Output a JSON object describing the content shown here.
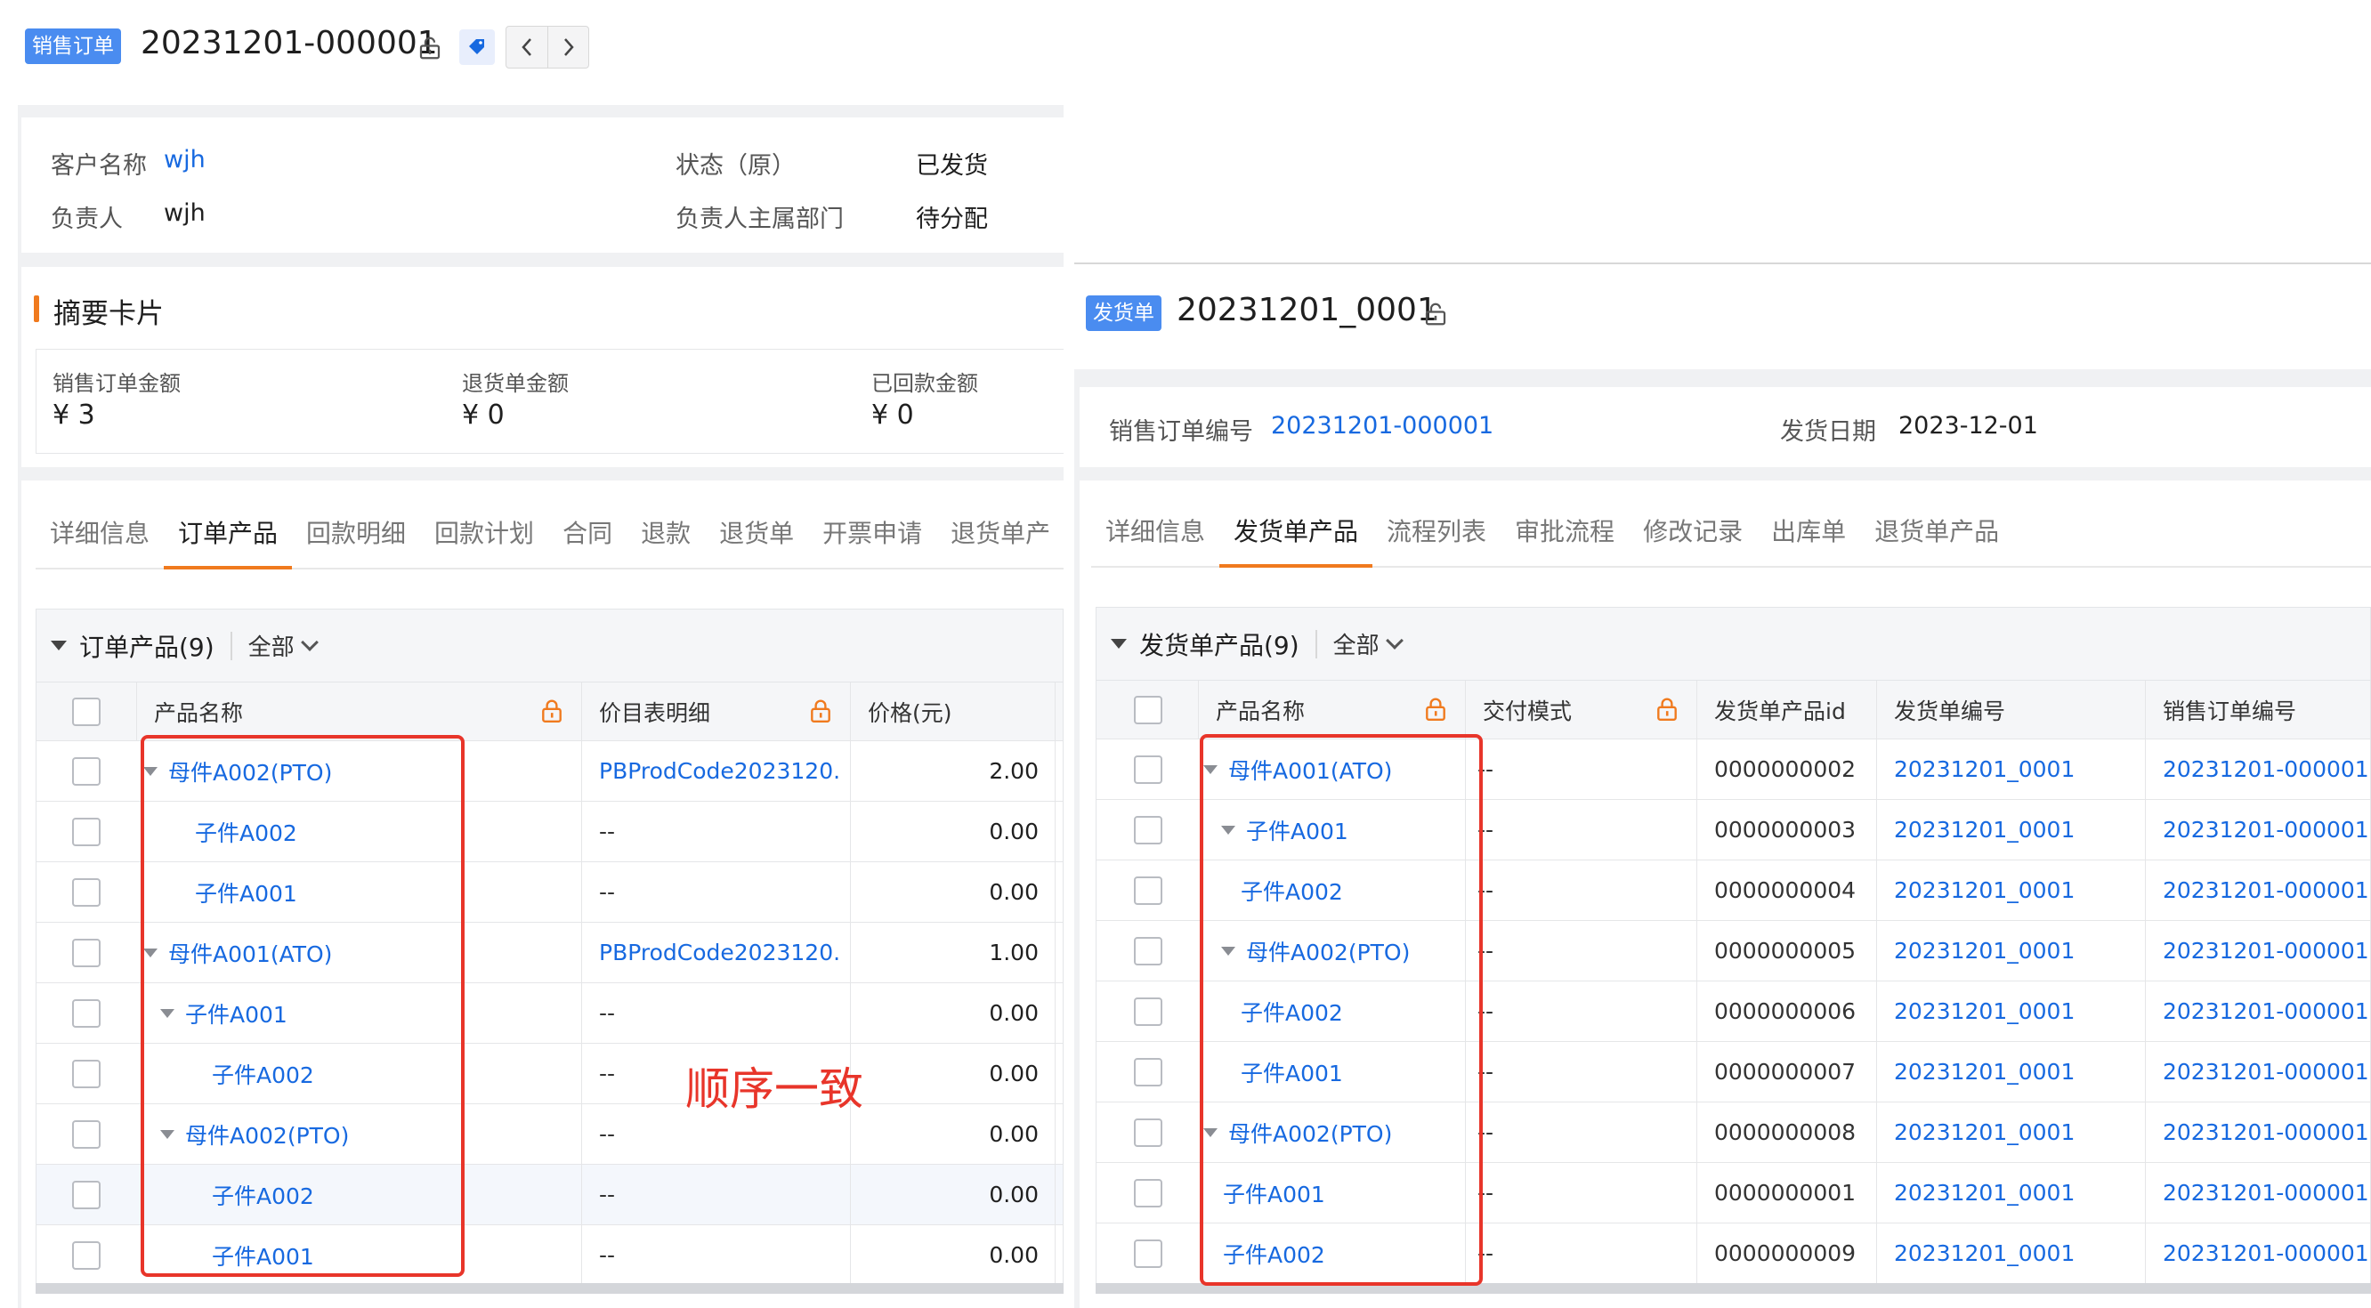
{
  "left": {
    "tag": "销售订单",
    "doc_no": "20231201-000001",
    "info": {
      "customer_label": "客户名称",
      "customer_value": "wjh",
      "status_label": "状态（原）",
      "status_value": "已发货",
      "owner_label": "负责人",
      "owner_value": "wjh",
      "dept_label": "负责人主属部门",
      "dept_value": "待分配"
    },
    "summary": {
      "title": "摘要卡片",
      "items": [
        {
          "label": "销售订单金额",
          "value": "¥ 3"
        },
        {
          "label": "退货单金额",
          "value": "¥ 0"
        },
        {
          "label": "已回款金额",
          "value": "¥ 0"
        }
      ]
    },
    "tabs": [
      "详细信息",
      "订单产品",
      "回款明细",
      "回款计划",
      "合同",
      "退款",
      "退货单",
      "开票申请",
      "退货单产"
    ],
    "active_tab": 1,
    "table": {
      "title": "订单产品(9)",
      "filter": "全部",
      "headers": [
        "产品名称",
        "价目表明细",
        "价格(元)"
      ],
      "rows": [
        {
          "name": "母件A002(PTO)",
          "detail": "PBProdCode2023120...",
          "price": "2.00"
        },
        {
          "name": "子件A002",
          "detail": "--",
          "price": "0.00"
        },
        {
          "name": "子件A001",
          "detail": "--",
          "price": "0.00"
        },
        {
          "name": "母件A001(ATO)",
          "detail": "PBProdCode2023120...",
          "price": "1.00"
        },
        {
          "name": "子件A001",
          "detail": "--",
          "price": "0.00"
        },
        {
          "name": "子件A002",
          "detail": "--",
          "price": "0.00"
        },
        {
          "name": "母件A002(PTO)",
          "detail": "--",
          "price": "0.00"
        },
        {
          "name": "子件A002",
          "detail": "--",
          "price": "0.00"
        },
        {
          "name": "子件A001",
          "detail": "--",
          "price": "0.00"
        }
      ]
    },
    "annotation": "顺序一致"
  },
  "right": {
    "tag": "发货单",
    "doc_no": "20231201_0001",
    "info": {
      "order_no_label": "销售订单编号",
      "order_no_value": "20231201-000001",
      "date_label": "发货日期",
      "date_value": "2023-12-01"
    },
    "tabs": [
      "详细信息",
      "发货单产品",
      "流程列表",
      "审批流程",
      "修改记录",
      "出库单",
      "退货单产品"
    ],
    "active_tab": 1,
    "table": {
      "title": "发货单产品(9)",
      "filter": "全部",
      "headers": [
        "产品名称",
        "交付模式",
        "发货单产品id",
        "发货单编号",
        "销售订单编号"
      ],
      "rows": [
        {
          "name": "母件A001(ATO)",
          "mode": "--",
          "pid": "0000000002",
          "ship_no": "20231201_0001",
          "order_no": "20231201-000001"
        },
        {
          "name": "子件A001",
          "mode": "--",
          "pid": "0000000003",
          "ship_no": "20231201_0001",
          "order_no": "20231201-000001"
        },
        {
          "name": "子件A002",
          "mode": "--",
          "pid": "0000000004",
          "ship_no": "20231201_0001",
          "order_no": "20231201-000001"
        },
        {
          "name": "母件A002(PTO)",
          "mode": "--",
          "pid": "0000000005",
          "ship_no": "20231201_0001",
          "order_no": "20231201-000001"
        },
        {
          "name": "子件A002",
          "mode": "--",
          "pid": "0000000006",
          "ship_no": "20231201_0001",
          "order_no": "20231201-000001"
        },
        {
          "name": "子件A001",
          "mode": "--",
          "pid": "0000000007",
          "ship_no": "20231201_0001",
          "order_no": "20231201-000001"
        },
        {
          "name": "母件A002(PTO)",
          "mode": "--",
          "pid": "0000000008",
          "ship_no": "20231201_0001",
          "order_no": "20231201-000001"
        },
        {
          "name": "子件A001",
          "mode": "--",
          "pid": "0000000001",
          "ship_no": "20231201_0001",
          "order_no": "20231201-000001"
        },
        {
          "name": "子件A002",
          "mode": "--",
          "pid": "0000000009",
          "ship_no": "20231201_0001",
          "order_no": "20231201-000001"
        }
      ]
    }
  },
  "colors": {
    "accent": "#1769e0",
    "tab_active": "#f07a1e",
    "annotation": "#e8352a",
    "tag_bg": "#4a8cf0"
  }
}
